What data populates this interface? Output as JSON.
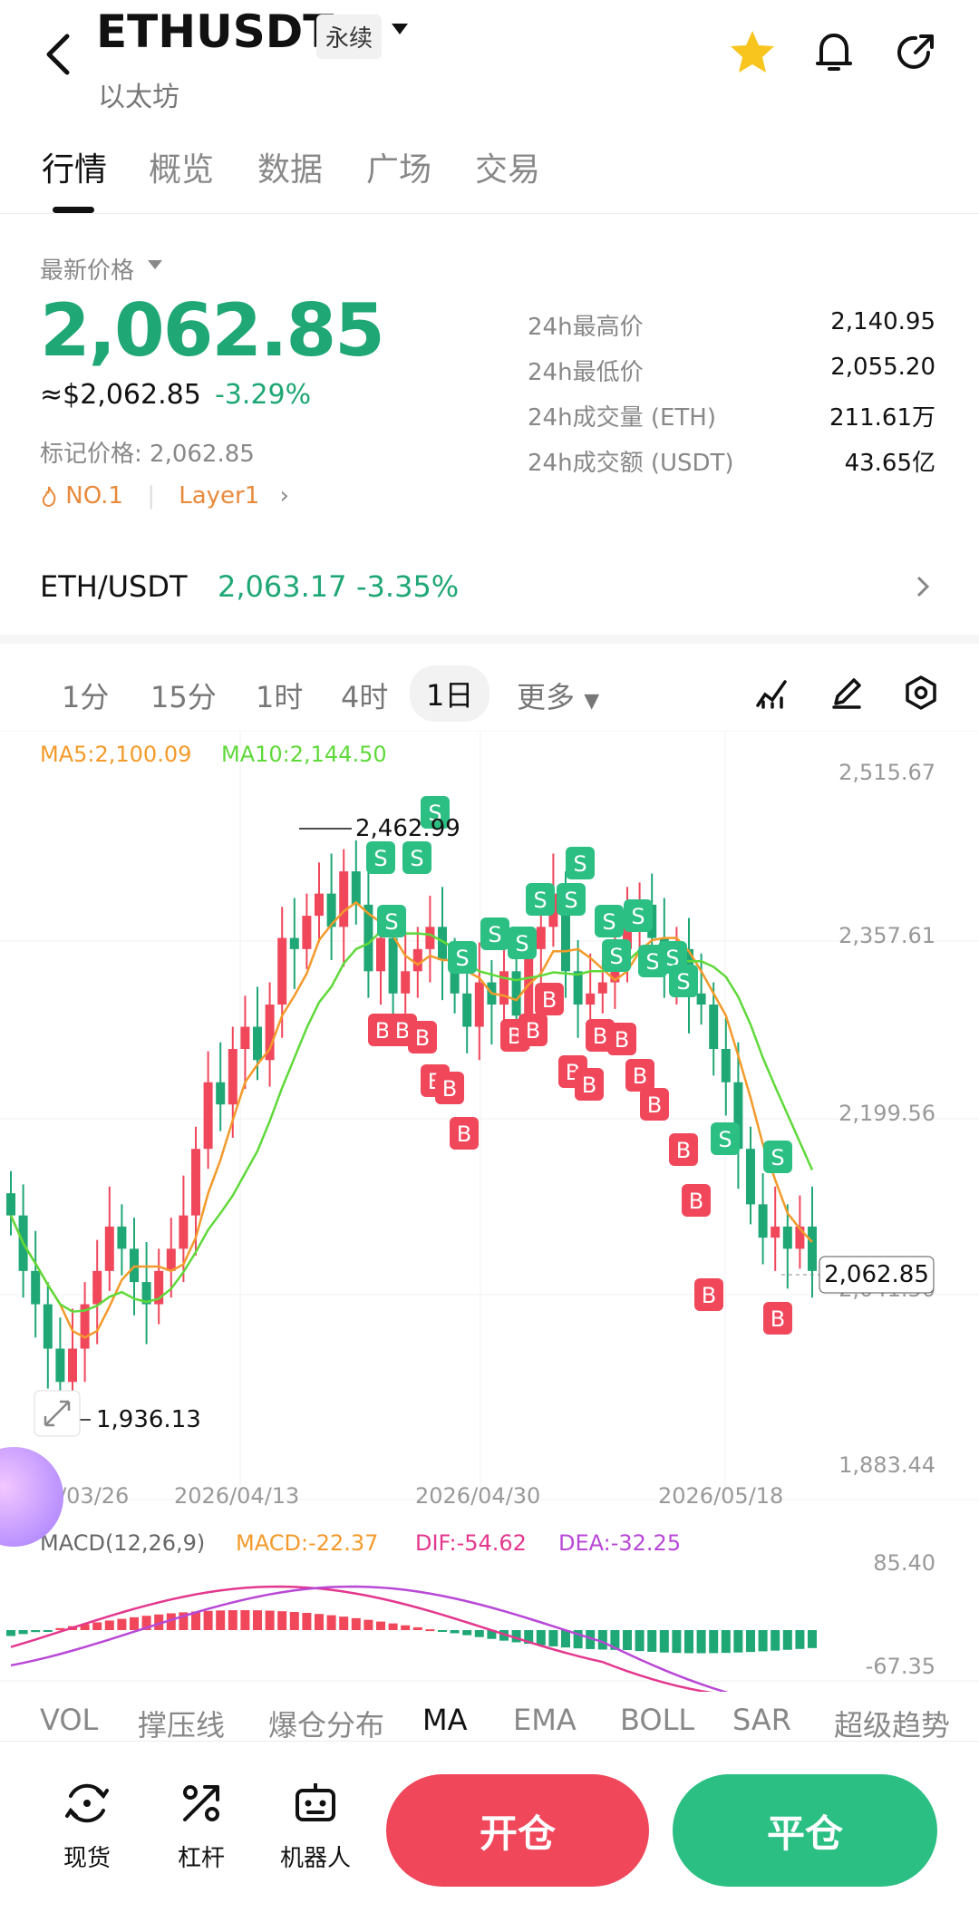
{
  "header": {
    "title": "ETHUSDT",
    "badge": "永续",
    "subtitle": "以太坊"
  },
  "tabs": [
    "行情",
    "概览",
    "数据",
    "广场",
    "交易"
  ],
  "price": {
    "latest_label": "最新价格",
    "latest": "2,062.85",
    "usd": "≈$2,062.85",
    "change": "-3.29%",
    "mark": "标记价格: 2,062.85",
    "tag_rank": "NO.1",
    "tag_sector": "Layer1"
  },
  "stats": [
    {
      "label": "24h最高价",
      "value": "2,140.95"
    },
    {
      "label": "24h最低价",
      "value": "2,055.20"
    },
    {
      "label": "24h成交量 (ETH)",
      "value": "211.61万"
    },
    {
      "label": "24h成交额 (USDT)",
      "value": "43.65亿"
    }
  ],
  "spot": {
    "pair": "ETH/USDT",
    "price": "2,063.17",
    "change": "-3.35%"
  },
  "intervals": [
    "1分",
    "15分",
    "1时",
    "4时",
    "1日",
    "更多"
  ],
  "colors": {
    "up": "#f0475b",
    "down": "#1fa775",
    "ma5": "#f39a2b",
    "ma10": "#5fd93a",
    "dif": "#e3388e",
    "dea": "#b848d6"
  },
  "chart": {
    "ma_legend": {
      "ma5": "MA5:2,100.09",
      "ma10": "MA10:2,144.50"
    },
    "y_ticks": [
      "2,515.67",
      "2,357.61",
      "2,199.56",
      "2,041.50",
      "1,883.44"
    ],
    "x_ticks": [
      "2026/03/26",
      "2026/04/13",
      "2026/04/30",
      "2026/05/18"
    ],
    "high_label": "2,462.99",
    "low_label": "1,936.13",
    "last_price": "2,062.85",
    "macd_legend": {
      "name": "MACD(12,26,9)",
      "macd": "MACD:-22.37",
      "dif": "DIF:-54.62",
      "dea": "DEA:-32.25"
    },
    "macd_ticks": [
      "85.40",
      "-67.35"
    ]
  },
  "indicator_tabs": [
    "VOL",
    "撑压线",
    "爆仓分布",
    "MA",
    "EMA",
    "BOLL",
    "SAR",
    "超级趋势"
  ],
  "toolbar": {
    "spot": "现货",
    "leverage": "杠杆",
    "robot": "机器人",
    "open": "开仓",
    "close": "平仓"
  }
}
